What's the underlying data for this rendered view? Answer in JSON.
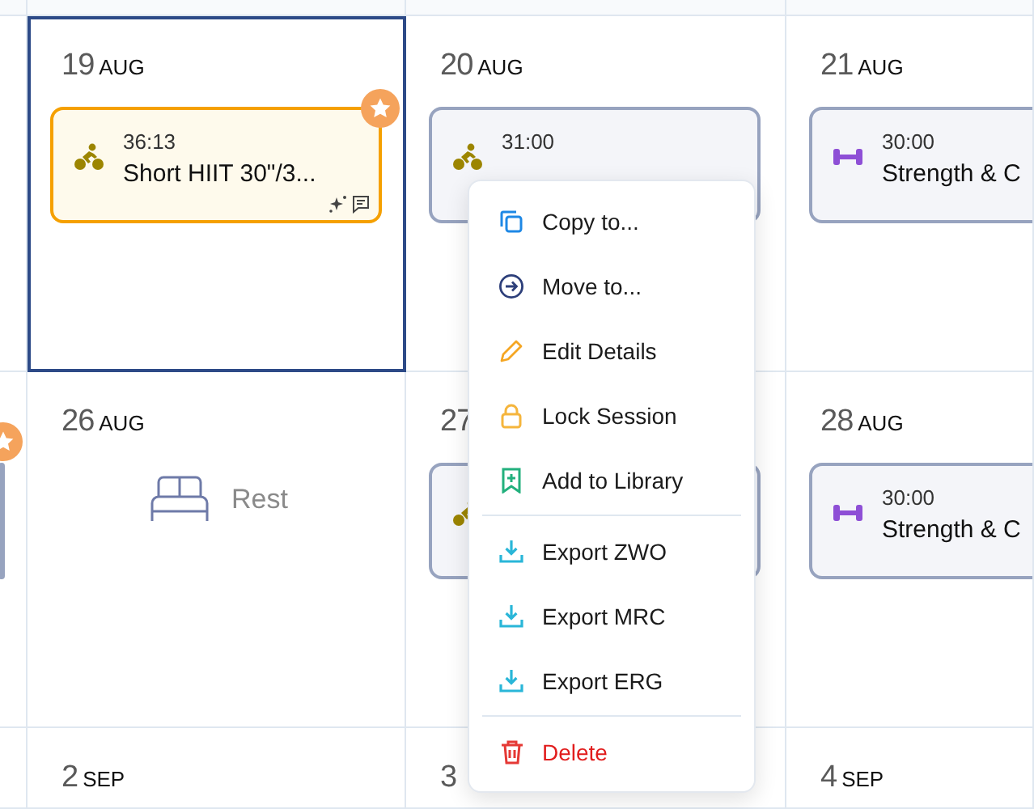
{
  "calendar": {
    "weeks": [
      {
        "days": [
          {
            "selected": false
          },
          {
            "date_number": "19",
            "month": "AUG",
            "selected": true,
            "cards": [
              {
                "kind": "cycling",
                "time": "36:13",
                "title": "Short HIIT 30\"/3...",
                "starred": true,
                "highlighted": true,
                "sparkle": true,
                "comment": true
              }
            ]
          },
          {
            "date_number": "20",
            "month": "AUG",
            "selected": false,
            "cards": [
              {
                "kind": "cycling",
                "time": "31:00",
                "starred": false,
                "highlighted": false,
                "sparkle": false,
                "comment": false
              }
            ]
          },
          {
            "date_number": "21",
            "month": "AUG",
            "selected": false,
            "cards": [
              {
                "kind": "strength",
                "time": "30:00",
                "title": "Strength & C",
                "starred": false,
                "highlighted": false,
                "sparkle": false,
                "comment": false
              }
            ]
          }
        ]
      },
      {
        "days": [
          {
            "selected": false,
            "cards": [
              {
                "starred": true,
                "highlighted": false
              }
            ]
          },
          {
            "date_number": "26",
            "month": "AUG",
            "selected": false,
            "rest": {
              "label": "Rest"
            }
          },
          {
            "date_number": "27",
            "selected": false,
            "cards": [
              {
                "kind": "cycling",
                "starred": false,
                "highlighted": false
              }
            ]
          },
          {
            "date_number": "28",
            "month": "AUG",
            "selected": false,
            "cards": [
              {
                "kind": "strength",
                "time": "30:00",
                "title": "Strength & C",
                "starred": false,
                "highlighted": false,
                "sparkle": false,
                "comment": false
              }
            ]
          }
        ]
      },
      {
        "days": [
          {
            "selected": false
          },
          {
            "date_number": "2",
            "month": "SEP",
            "selected": false
          },
          {
            "date_number": "3",
            "selected": false
          },
          {
            "date_number": "4",
            "month": "SEP",
            "selected": false
          }
        ]
      }
    ]
  },
  "context_menu": {
    "items": [
      {
        "kind": "copy",
        "label": "Copy to..."
      },
      {
        "kind": "move",
        "label": "Move to..."
      },
      {
        "kind": "edit",
        "label": "Edit Details"
      },
      {
        "kind": "lock",
        "label": "Lock Session"
      },
      {
        "kind": "library",
        "label": "Add to Library"
      },
      {
        "kind": "divider"
      },
      {
        "kind": "export",
        "label": "Export ZWO"
      },
      {
        "kind": "export",
        "label": "Export MRC"
      },
      {
        "kind": "export",
        "label": "Export ERG"
      },
      {
        "kind": "divider"
      },
      {
        "kind": "delete",
        "label": "Delete"
      }
    ]
  }
}
